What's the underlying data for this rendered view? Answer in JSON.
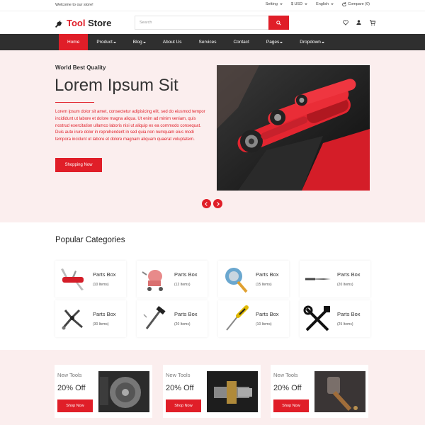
{
  "topbar": {
    "welcome": "Welcome to our store!",
    "setting": "Setting",
    "currency": "$ USD",
    "language": "English",
    "compare": "Compare (0)"
  },
  "header": {
    "logo_word1": "Tool",
    "logo_word2": "Store",
    "search_placeholder": "Search",
    "icons": [
      "wrench-icon",
      "search-icon",
      "heart-icon",
      "user-icon",
      "cart-icon"
    ]
  },
  "nav": {
    "items": [
      "Home",
      "Product",
      "Blog",
      "About Us",
      "Services",
      "Contact",
      "Pages",
      "Dropdown"
    ]
  },
  "hero": {
    "subtitle": "World Best Quality",
    "title": "Lorem Ipsum Sit",
    "description": "Lorem ipsum dolor sit amet, consectetur adipisicing elit, sed do eiusmod tempor incididunt ut labore et dolore magna aliqua. Ut enim ad minim veniam, quis nostrud exercitation ullamco laboris nisi ut aliquip ex ea commodo consequat. Duis aute irure dolor in reprehenderit in sed quia non numquam eius modi tempora incidunt ut labore et dolore magnam aliquam quaerat voluptatem.",
    "button": "Shopping Now"
  },
  "categories": {
    "title": "Popular Categories",
    "items": [
      {
        "name": "Parts Box",
        "count": "(10 Items)"
      },
      {
        "name": "Parts Box",
        "count": "(12 Items)"
      },
      {
        "name": "Parts Box",
        "count": "(15 Items)"
      },
      {
        "name": "Parts Box",
        "count": "(20 Items)"
      },
      {
        "name": "Parts Box",
        "count": "(30 Items)"
      },
      {
        "name": "Parts Box",
        "count": "(20 Items)"
      },
      {
        "name": "Parts Box",
        "count": "(10 Items)"
      },
      {
        "name": "Parts Box",
        "count": "(25 Items)"
      }
    ]
  },
  "promos": [
    {
      "label": "New Tools",
      "off": "20% Off",
      "button": "Shop Now"
    },
    {
      "label": "New Tools",
      "off": "20% Off",
      "button": "Shop Now"
    },
    {
      "label": "New Tools",
      "off": "20% Off",
      "button": "Shop Now"
    }
  ],
  "colors": {
    "accent": "#e01e28",
    "nav_bg": "#2f2f2f",
    "hero_bg": "#fbeeee"
  }
}
